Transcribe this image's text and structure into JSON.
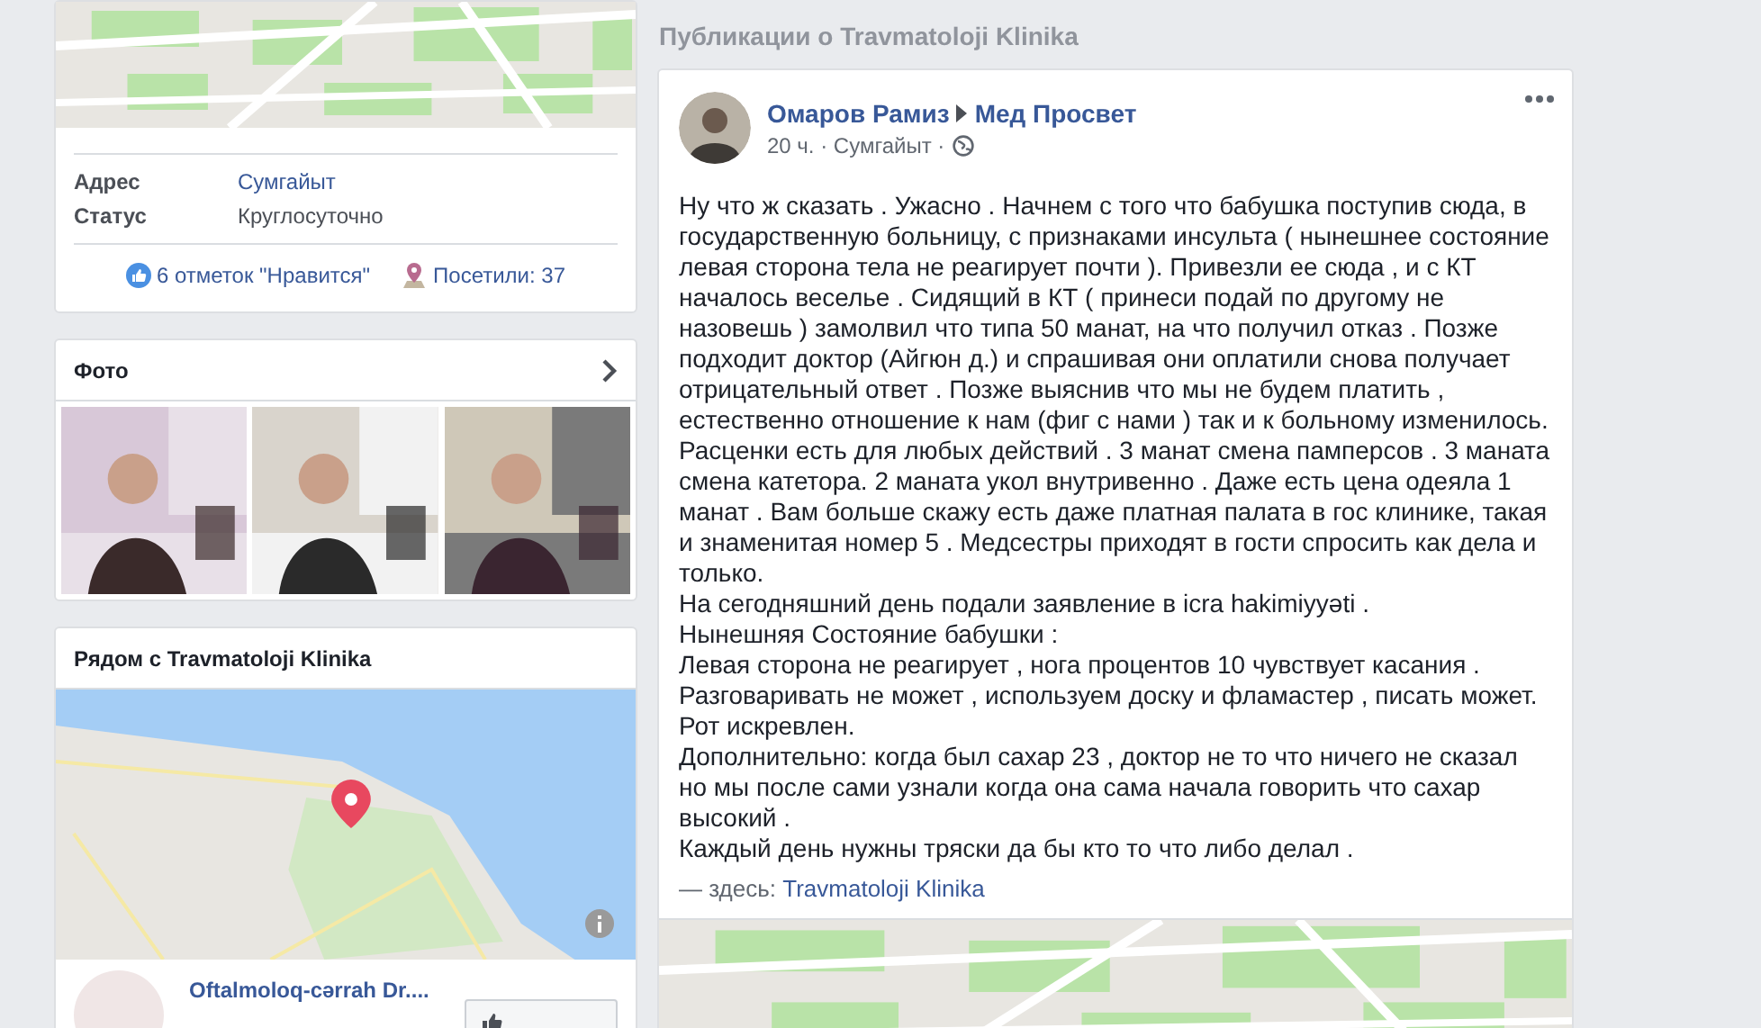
{
  "place_card": {
    "rows": [
      {
        "label": "Адрес",
        "value": "Сумгайыт",
        "kind": "link"
      },
      {
        "label": "Статус",
        "value": "Круглосуточно",
        "kind": "text"
      }
    ],
    "likes": "6 отметок \"Нравится\"",
    "visits": "Посетили: 37"
  },
  "photos": {
    "title": "Фото"
  },
  "nearby": {
    "title": "Рядом с Travmatoloji Klinika",
    "places": [
      {
        "name": "Oftalmoloq-cərrah Dr...."
      }
    ]
  },
  "posts_section": {
    "title": "Публикации о Travmatoloji Klinika",
    "posts": [
      {
        "author": "Омаров Рамиз",
        "target": "Мед Просвет",
        "meta": "20 ч. · Сумгайыт ·",
        "paragraphs": [
          "Ну что ж сказать . Ужасно . Начнем с того что бабушка поступив сюда, в государственную больницу, с признаками инсульта ( нынешнее состояние левая сторона тела не реагирует почти ). Привезли ее сюда , и с КТ началось веселье . Сидящий в КТ ( принеси подай по другому не назовешь ) замолвил что типа 50 манат, на что получил отказ . Позже подходит доктор (Айгюн д.) и спрашивая они оплатили снова получает отрицательный ответ . Позже выяснив что мы не будем платить , естественно отношение к нам (фиг с нами ) так и к больному изменилось. Расценки есть для любых действий . 3 манат смена памперсов . 3 маната смена катетора. 2 маната укол внутривенно . Даже есть цена одеяла 1 манат . Вам больше скажу есть даже платная палата в гос клинике, такая и знаменитая номер 5 . Медсестры приходят в гости спросить как дела и только.",
          "На сегодняшний день подали заявление в icra hakimiyyəti .",
          "Нынешняя Состояние бабушки :",
          "Левая сторона не реагирует , нога процентов 10 чувствует касания .",
          "Разговаривать не может , используем доску и фламастер , писать может.",
          "Рот искревлен.",
          "Дополнительно: когда был сахар 23 , доктор не то что ничего не сказал но мы после сами узнали когда она сама начала говорить что сахар высокий .",
          "Каждый день нужны тряски да бы кто то что либо делал ."
        ],
        "checkin_prefix": "— здесь:",
        "checkin_place": "Travmatoloji Klinika"
      }
    ]
  }
}
